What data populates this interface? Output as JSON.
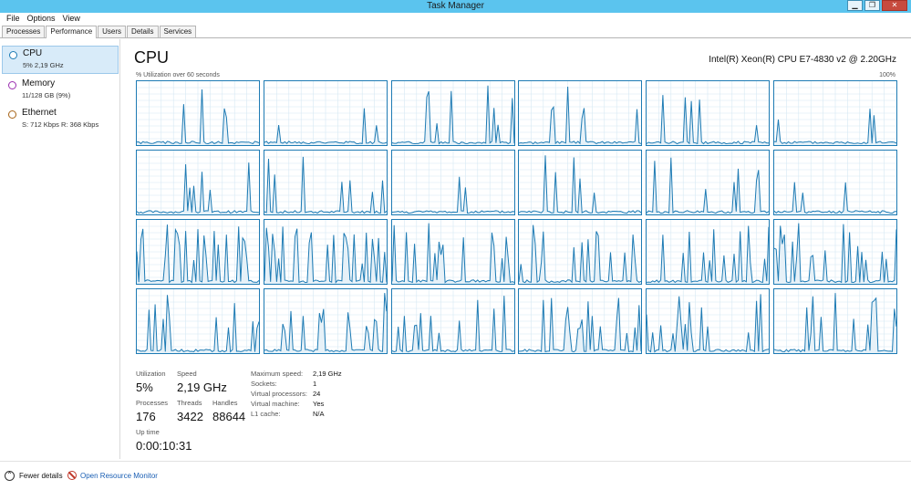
{
  "window": {
    "title": "Task Manager",
    "minimize": "▁",
    "maximize": "❐",
    "close": "✕"
  },
  "menu": [
    "File",
    "Options",
    "View"
  ],
  "tabs": [
    "Processes",
    "Performance",
    "Users",
    "Details",
    "Services"
  ],
  "active_tab": "Performance",
  "sidebar": [
    {
      "title": "CPU",
      "sub": "5% 2,19 GHz",
      "color": "#1e7bb4",
      "selected": true
    },
    {
      "title": "Memory",
      "sub": "11/128 GB (9%)",
      "color": "#9b2fb0",
      "selected": false
    },
    {
      "title": "Ethernet",
      "sub": "S: 712 Kbps R: 368 Kbps",
      "color": "#a8661b",
      "selected": false
    }
  ],
  "main": {
    "title": "CPU",
    "cpu_name": "Intel(R) Xeon(R) CPU E7-4830 v2 @ 2.20GHz",
    "util_label": "% Utilization over 60 seconds",
    "max_label": "100%"
  },
  "stats": {
    "utilization_label": "Utilization",
    "utilization": "5%",
    "speed_label": "Speed",
    "speed": "2,19 GHz",
    "processes_label": "Processes",
    "processes": "176",
    "threads_label": "Threads",
    "threads": "3422",
    "handles_label": "Handles",
    "handles": "88644",
    "uptime_label": "Up time",
    "uptime": "0:00:10:31"
  },
  "details": [
    {
      "key": "Maximum speed:",
      "value": "2,19 GHz"
    },
    {
      "key": "Sockets:",
      "value": "1"
    },
    {
      "key": "Virtual processors:",
      "value": "24"
    },
    {
      "key": "Virtual machine:",
      "value": "Yes"
    },
    {
      "key": "L1 cache:",
      "value": "N/A"
    }
  ],
  "footer": {
    "fewer_details": "Fewer details",
    "open_resource_monitor": "Open Resource Monitor"
  },
  "colors": {
    "graph_line": "#1e7bb4",
    "graph_fill": "#e6f1f8",
    "graph_grid": "#d6e8f3",
    "titlebar": "#5bc4ee"
  },
  "cpu_graph_count": 24
}
